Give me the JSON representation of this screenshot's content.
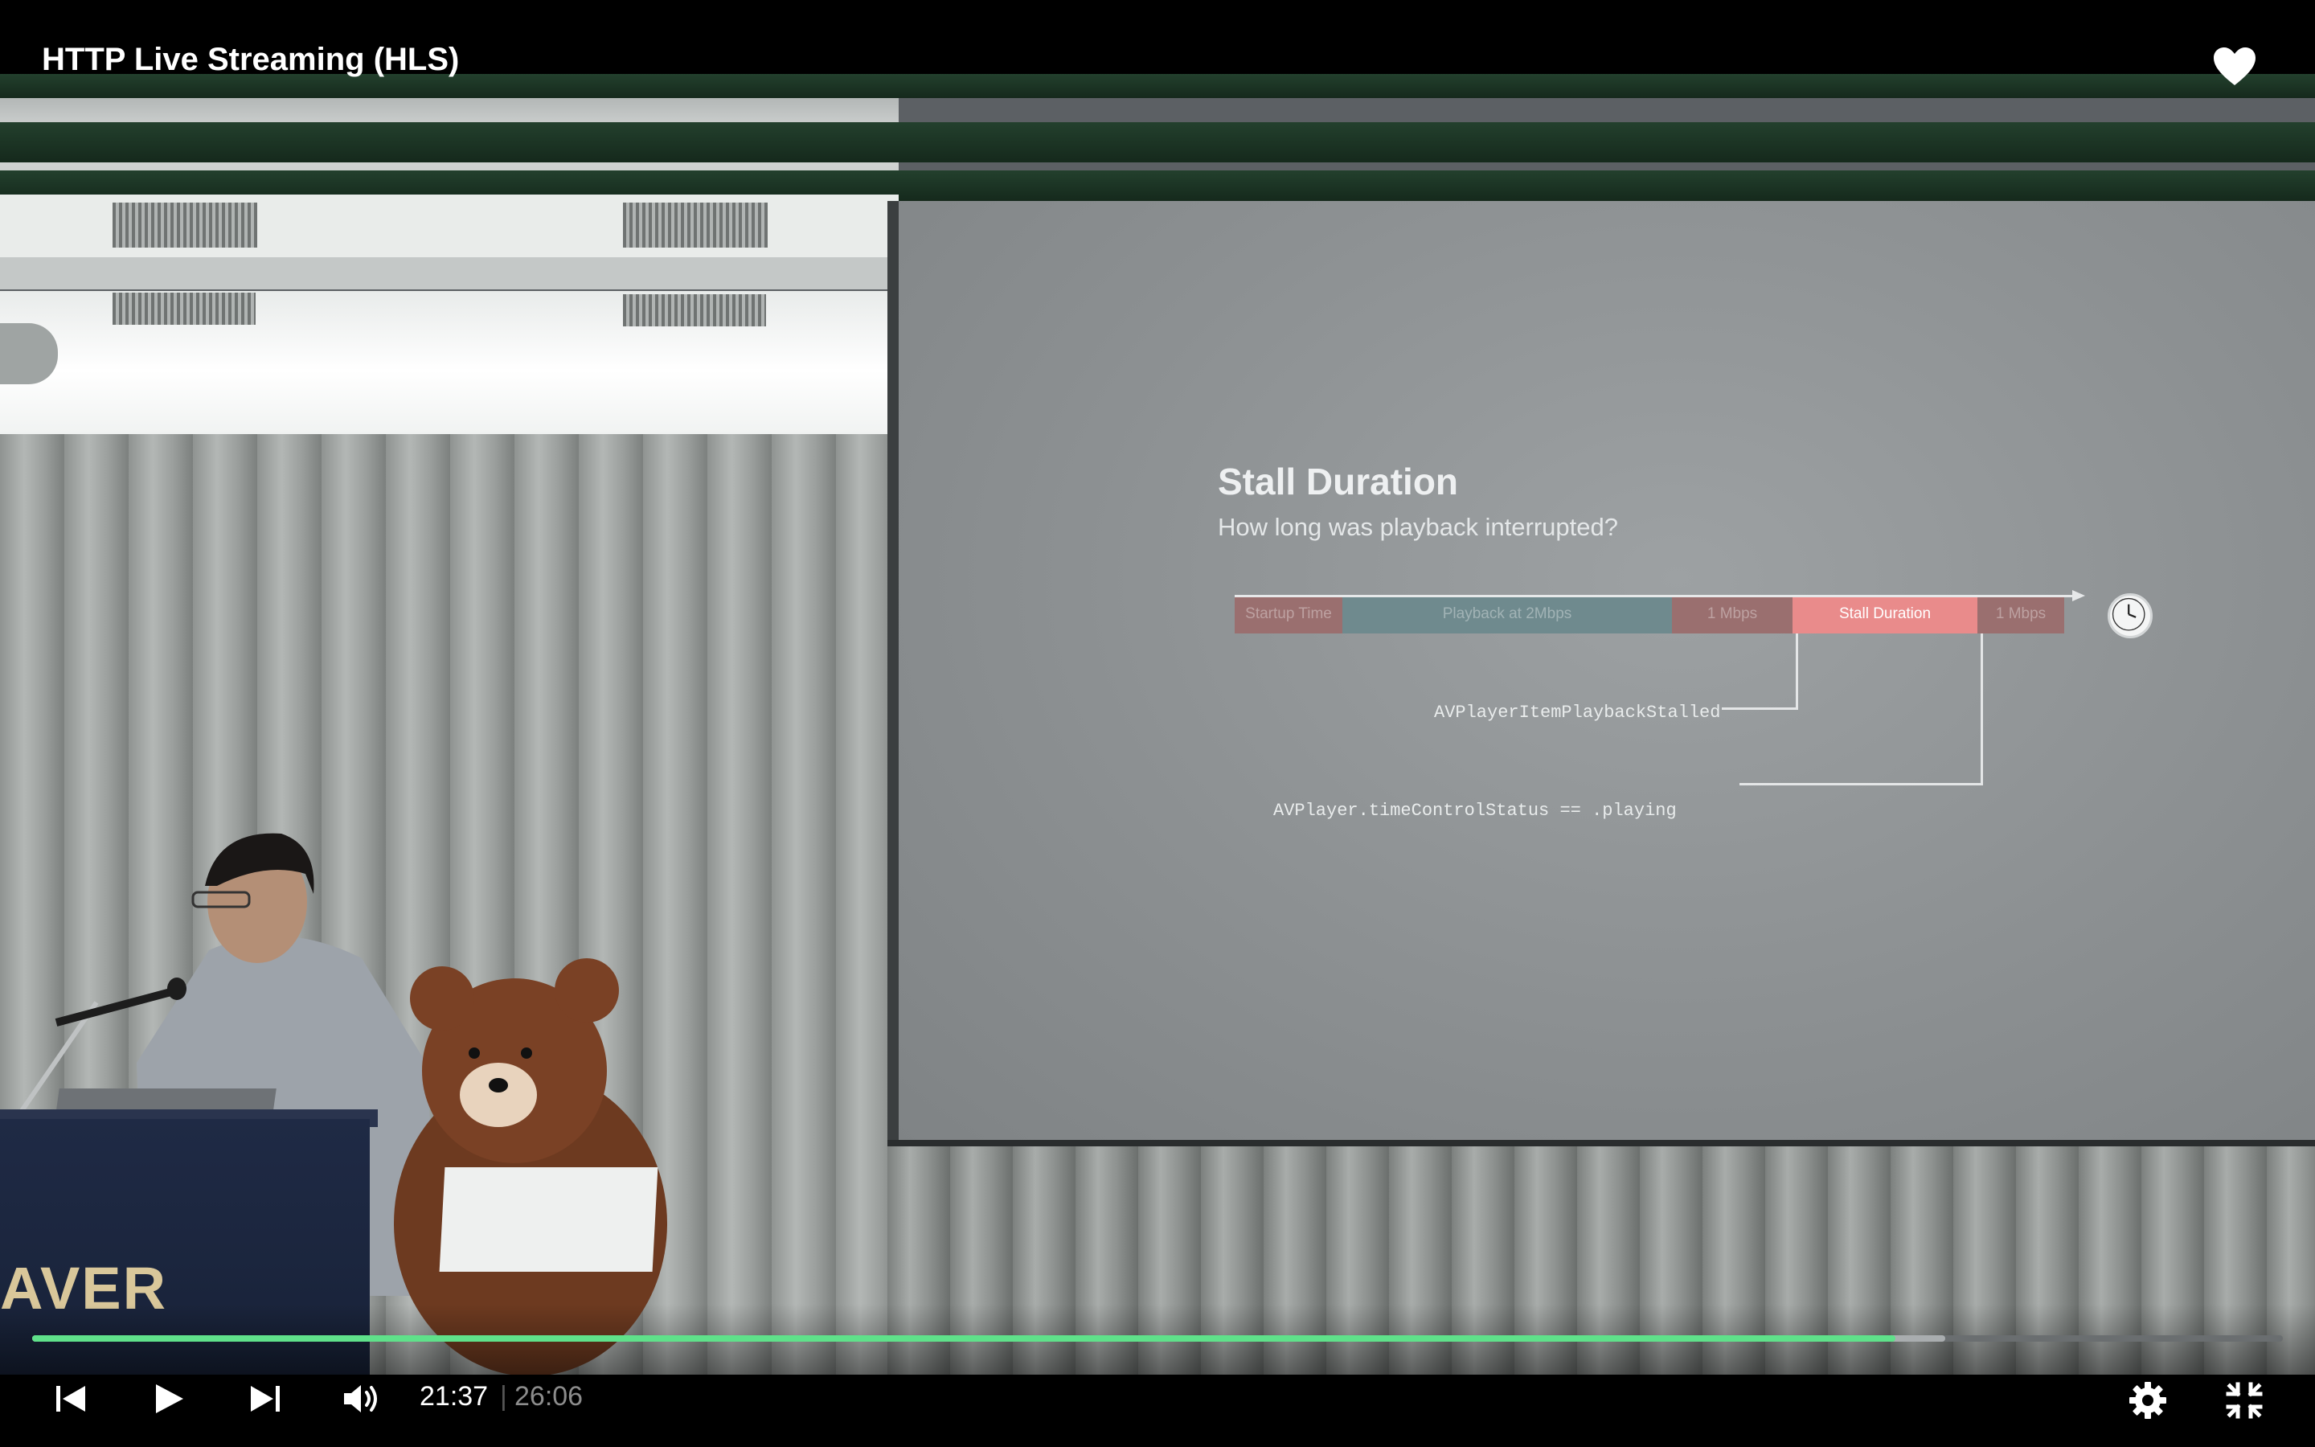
{
  "player": {
    "title": "HTTP Live Streaming (HLS)",
    "current_time": "21:37",
    "separator": "|",
    "duration": "26:06",
    "progress_fraction": 0.828,
    "buffered_fraction": 0.85,
    "accent_color": "#5fe18a"
  },
  "slide": {
    "title": "Stall Duration",
    "subtitle": "How long was playback interrupted?",
    "timeline": [
      {
        "label": "Startup Time",
        "color": "#9a6f6f"
      },
      {
        "label": "Playback at 2Mbps",
        "color": "#6f8a8e"
      },
      {
        "label": "1 Mbps",
        "color": "#9a6f6f"
      },
      {
        "label": "Stall Duration",
        "color": "#e98b8b"
      },
      {
        "label": "1 Mbps",
        "color": "#9a6f6f"
      }
    ],
    "code_stalled": "AVPlayerItemPlaybackStalled",
    "code_playing": "AVPlayer.timeControlStatus == .playing"
  },
  "scene": {
    "podium_logo": "AVER"
  },
  "icons": {
    "heart": "heart-icon",
    "prev": "skip-previous-icon",
    "play": "play-icon",
    "next": "skip-next-icon",
    "volume": "volume-icon",
    "settings": "gear-icon",
    "exit_fullscreen": "exit-fullscreen-icon"
  }
}
